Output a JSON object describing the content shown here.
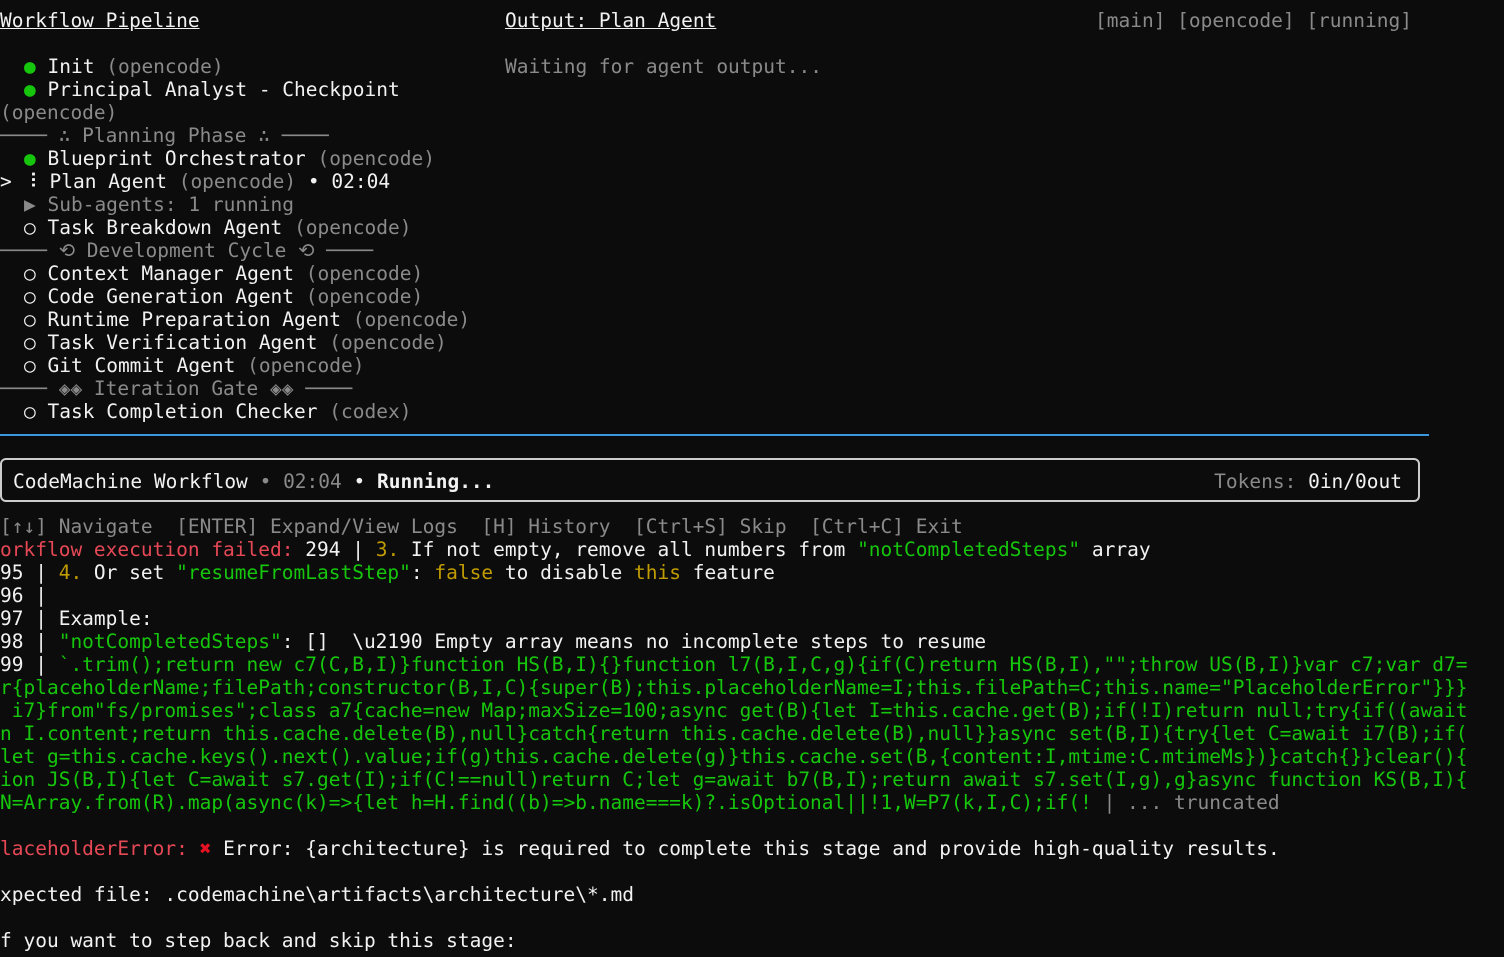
{
  "header": {
    "pipeline_title": "Workflow Pipeline",
    "output_title": "Output: Plan Agent",
    "tags": "[main] [opencode] [running]"
  },
  "output": {
    "waiting": "Waiting for agent output..."
  },
  "pipeline": {
    "init": {
      "bullet": "●",
      "name": "Init",
      "engine": "(opencode)"
    },
    "principal": {
      "bullet": "●",
      "name": "Principal Analyst - Checkpoint",
      "engine": "(opencode)"
    },
    "sep_planning": "──── ∴ Planning Phase ∴ ────",
    "blueprint": {
      "bullet": "●",
      "name": "Blueprint Orchestrator",
      "engine": "(opencode)"
    },
    "plan": {
      "cursor": ">",
      "bullet": "⠸",
      "name": "Plan Agent",
      "engine": "(opencode)",
      "sep": "•",
      "time": "02:04"
    },
    "subagents": "▶ Sub-agents: 1 running",
    "task_breakdown": {
      "bullet": "○",
      "name": "Task Breakdown Agent",
      "engine": "(opencode)"
    },
    "sep_dev": "──── ⟲ Development Cycle ⟲ ────",
    "context_mgr": {
      "bullet": "○",
      "name": "Context Manager Agent",
      "engine": "(opencode)"
    },
    "code_gen": {
      "bullet": "○",
      "name": "Code Generation Agent",
      "engine": "(opencode)"
    },
    "runtime_prep": {
      "bullet": "○",
      "name": "Runtime Preparation Agent",
      "engine": "(opencode)"
    },
    "task_verif": {
      "bullet": "○",
      "name": "Task Verification Agent",
      "engine": "(opencode)"
    },
    "git_commit": {
      "bullet": "○",
      "name": "Git Commit Agent",
      "engine": "(opencode)"
    },
    "sep_gate": "──── ◈◈ Iteration Gate ◈◈ ────",
    "completion": {
      "bullet": "○",
      "name": "Task Completion Checker",
      "engine": "(codex)"
    }
  },
  "status": {
    "title": "CodeMachine Workflow",
    "sep1": "•",
    "time": "02:04",
    "sep2": "•",
    "state": "Running...",
    "tokens_label": "Tokens:",
    "tokens_value": "0in/0out"
  },
  "keys": "[↑↓] Navigate  [ENTER] Expand/View Logs  [H] History  [Ctrl+S] Skip  [Ctrl+C] Exit",
  "log": {
    "l1_err": "orkflow execution failed: ",
    "l1_num": "294 | ",
    "l1_idx": "3.",
    "l1_text1": " If not empty, remove all numbers from ",
    "l1_str": "\"notCompletedSteps\"",
    "l1_text2": " array",
    "l2_num": "95 | ",
    "l2_idx": "4.",
    "l2_text1": " Or set ",
    "l2_str": "\"resumeFromLastStep\"",
    "l2_text2": ": ",
    "l2_false": "false",
    "l2_text3": " to disable ",
    "l2_this": "this",
    "l2_text4": " feature",
    "l3": "96 |",
    "l4_num": "97 | ",
    "l4_text": "Example:",
    "l5_num": "98 | ",
    "l5_str": "\"notCompletedSteps\"",
    "l5_text": ": []  \\u2190 Empty array means no incomplete steps to resume",
    "l6_num": "99 | ",
    "l6_code": "`.trim();return new c7(C,B,I)}function HS(B,I){}function l7(B,I,C,g){if(C)return HS(B,I),\"\";throw US(B,I)}var c7;var d7=",
    "l7_code": "r{placeholderName;filePath;constructor(B,I,C){super(B);this.placeholderName=I;this.filePath=C;this.name=\"PlaceholderError\"}}}",
    "l8_code": " i7}from\"fs/promises\";class a7{cache=new Map;maxSize=100;async get(B){let I=this.cache.get(B);if(!I)return null;try{if((await",
    "l9_code": "n I.content;return this.cache.delete(B),null}catch{return this.cache.delete(B),null}}async set(B,I){try{let C=await i7(B);if(",
    "l10_code": "let g=this.cache.keys().next().value;if(g)this.cache.delete(g)}this.cache.set(B,{content:I,mtime:C.mtimeMs})}catch{}}clear(){",
    "l11_code": "ion JS(B,I){let C=await s7.get(I);if(C!==null)return C;let g=await b7(B,I);return await s7.set(I,g),g}async function KS(B,I){",
    "l12_code": "N=Array.from(R).map(async(k)=>{let h=H.find((b)=>b.name===k)?.isOptional||!1,W=P7(k,I,C);if(! ",
    "l12_trunc": "| ... truncated",
    "l13_err": "laceholderError:",
    "l13_x": "✖",
    "l13_text": "Error: {architecture} is required to complete this stage and provide high-quality results.",
    "l14": "xpected file: .codemachine\\artifacts\\architecture\\*.md",
    "l15": "f you want to step back and skip this stage:"
  }
}
